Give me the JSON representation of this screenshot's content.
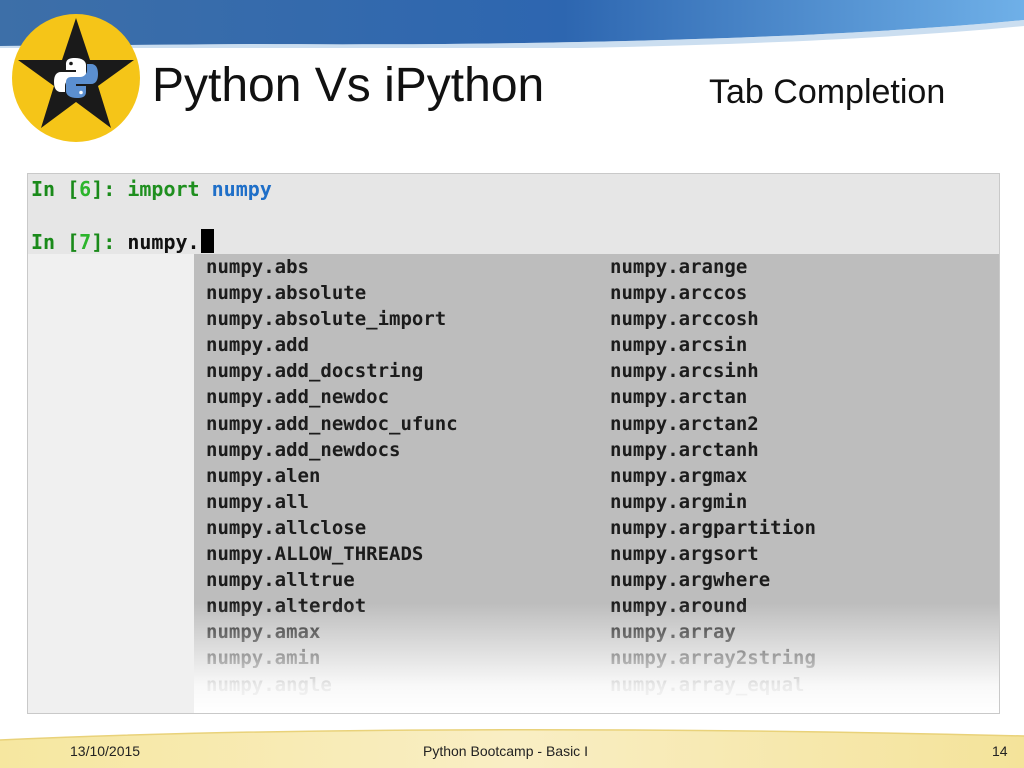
{
  "slide": {
    "title": "Python Vs iPython",
    "subtitle": "Tab Completion"
  },
  "terminal": {
    "line1": {
      "prompt_in": "In [",
      "prompt_num": "6",
      "prompt_end": "]: ",
      "keyword": "import",
      "module": "numpy"
    },
    "line2": {
      "prompt_in": "In [",
      "prompt_num": "7",
      "prompt_end": "]: ",
      "code": "numpy."
    },
    "completions_left": [
      "numpy.abs",
      "numpy.absolute",
      "numpy.absolute_import",
      "numpy.add",
      "numpy.add_docstring",
      "numpy.add_newdoc",
      "numpy.add_newdoc_ufunc",
      "numpy.add_newdocs",
      "numpy.alen",
      "numpy.all",
      "numpy.allclose",
      "numpy.ALLOW_THREADS",
      "numpy.alltrue",
      "numpy.alterdot",
      "numpy.amax",
      "numpy.amin",
      "numpy.angle"
    ],
    "completions_right": [
      "numpy.arange",
      "numpy.arccos",
      "numpy.arccosh",
      "numpy.arcsin",
      "numpy.arcsinh",
      "numpy.arctan",
      "numpy.arctan2",
      "numpy.arctanh",
      "numpy.argmax",
      "numpy.argmin",
      "numpy.argpartition",
      "numpy.argsort",
      "numpy.argwhere",
      "numpy.around",
      "numpy.array",
      "numpy.array2string",
      "numpy.array_equal"
    ]
  },
  "footer": {
    "date": "13/10/2015",
    "center": "Python Bootcamp - Basic I",
    "page": "14"
  },
  "icons": {
    "logo": "python-star-logo-icon"
  },
  "colors": {
    "band_blue": "#2f6fb3",
    "star_yellow": "#f5c518",
    "footer_yellow": "#f7e8a8",
    "popup_gray": "#bdbdbd"
  }
}
